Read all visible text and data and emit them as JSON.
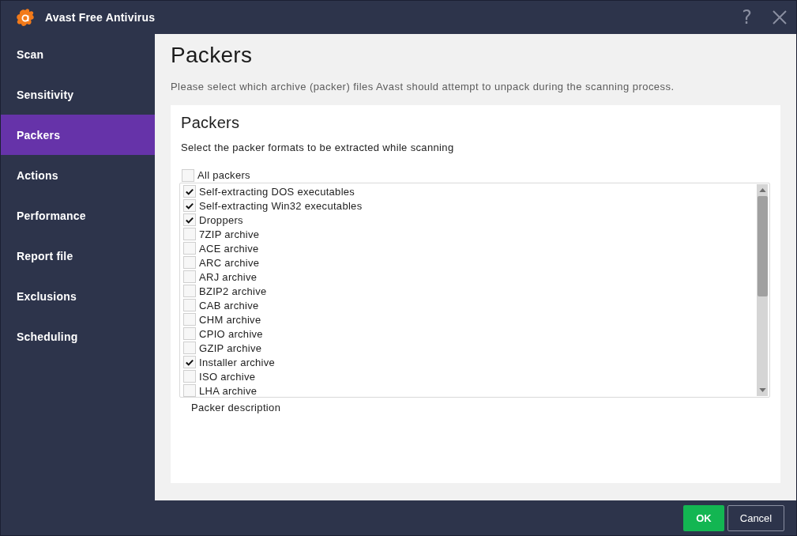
{
  "window": {
    "title": "Avast Free Antivirus",
    "help_label": "?"
  },
  "sidebar": {
    "items": [
      {
        "label": "Scan",
        "selected": false
      },
      {
        "label": "Sensitivity",
        "selected": false
      },
      {
        "label": "Packers",
        "selected": true
      },
      {
        "label": "Actions",
        "selected": false
      },
      {
        "label": "Performance",
        "selected": false
      },
      {
        "label": "Report file",
        "selected": false
      },
      {
        "label": "Exclusions",
        "selected": false
      },
      {
        "label": "Scheduling",
        "selected": false
      }
    ]
  },
  "page": {
    "title": "Packers",
    "description": "Please select which archive (packer) files Avast should attempt to unpack during the scanning process."
  },
  "panel": {
    "title": "Packers",
    "instruction": "Select the packer formats to be extracted while scanning",
    "all_packers": {
      "label": "All packers",
      "checked": false
    },
    "packers": [
      {
        "label": "Self-extracting DOS executables",
        "checked": true
      },
      {
        "label": "Self-extracting Win32 executables",
        "checked": true
      },
      {
        "label": "Droppers",
        "checked": true
      },
      {
        "label": "7ZIP archive",
        "checked": false
      },
      {
        "label": "ACE archive",
        "checked": false
      },
      {
        "label": "ARC archive",
        "checked": false
      },
      {
        "label": "ARJ archive",
        "checked": false
      },
      {
        "label": "BZIP2 archive",
        "checked": false
      },
      {
        "label": "CAB archive",
        "checked": false
      },
      {
        "label": "CHM archive",
        "checked": false
      },
      {
        "label": "CPIO archive",
        "checked": false
      },
      {
        "label": "GZIP archive",
        "checked": false
      },
      {
        "label": "Installer archive",
        "checked": true
      },
      {
        "label": "ISO archive",
        "checked": false
      },
      {
        "label": "LHA archive",
        "checked": false
      }
    ],
    "description_label": "Packer description"
  },
  "buttons": [
    {
      "label": "OK",
      "kind": "primary"
    },
    {
      "label": "Cancel",
      "kind": "secondary"
    }
  ]
}
